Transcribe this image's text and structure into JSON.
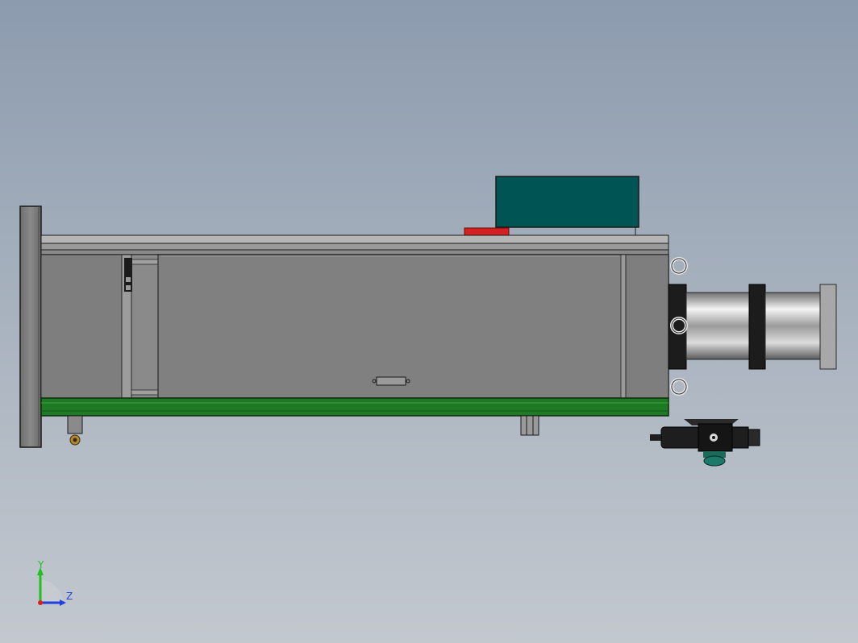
{
  "viewport": {
    "background_top": "#8c9bae",
    "background_bottom": "#c3c8cf"
  },
  "model": {
    "frame_color": "#808080",
    "base_color": "#1e7a24",
    "control_box_color": "#005454",
    "indicator_color": "#d42020",
    "cylinder_color": "#c8c8c8",
    "valve_color": "#202020"
  },
  "triad": {
    "y_label": "Y",
    "z_label": "Z",
    "y_color": "#20c020",
    "z_color": "#2040e0",
    "x_color": "#e02020"
  }
}
